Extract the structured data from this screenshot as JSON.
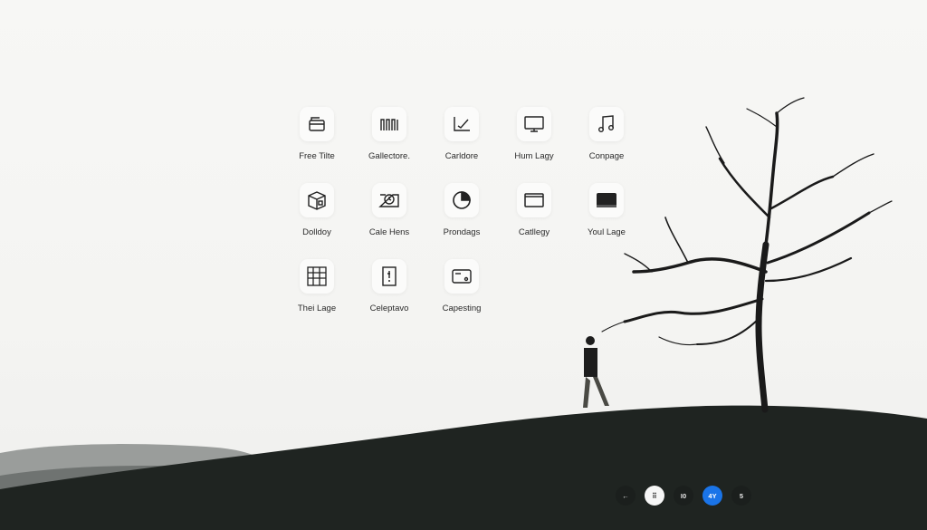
{
  "apps": [
    {
      "label": "Free Tilte",
      "icon": "cooking-pot-icon"
    },
    {
      "label": "Gallectore.",
      "icon": "waveform-icon"
    },
    {
      "label": "Carldore",
      "icon": "chart-check-icon"
    },
    {
      "label": "Hum Lagy",
      "icon": "monitor-icon"
    },
    {
      "label": "Conpage",
      "icon": "music-note-icon"
    },
    {
      "label": "Dolldoy",
      "icon": "box-icon"
    },
    {
      "label": "Cale Hens",
      "icon": "clock-frame-icon"
    },
    {
      "label": "Prondags",
      "icon": "pie-chart-icon"
    },
    {
      "label": "Catllegy",
      "icon": "window-icon"
    },
    {
      "label": "Youl Lage",
      "icon": "dark-panel-icon"
    },
    {
      "label": "Thei Lage",
      "icon": "calendar-grid-icon"
    },
    {
      "label": "Celeptavo",
      "icon": "document-icon"
    },
    {
      "label": "Capesting",
      "icon": "card-icon"
    }
  ],
  "dock": [
    {
      "label": "←",
      "icon": "back-arrow-icon",
      "style": "dark"
    },
    {
      "label": "⠿",
      "icon": "grid-dots-icon",
      "style": "white"
    },
    {
      "label": "I0",
      "icon": "",
      "style": "dark"
    },
    {
      "label": "4Y",
      "icon": "",
      "style": "blue"
    },
    {
      "label": "5",
      "icon": "",
      "style": "dark"
    }
  ],
  "colors": {
    "accent": "#1a74e8",
    "hill": "#1f2421",
    "sky": "#f6f6f4"
  }
}
